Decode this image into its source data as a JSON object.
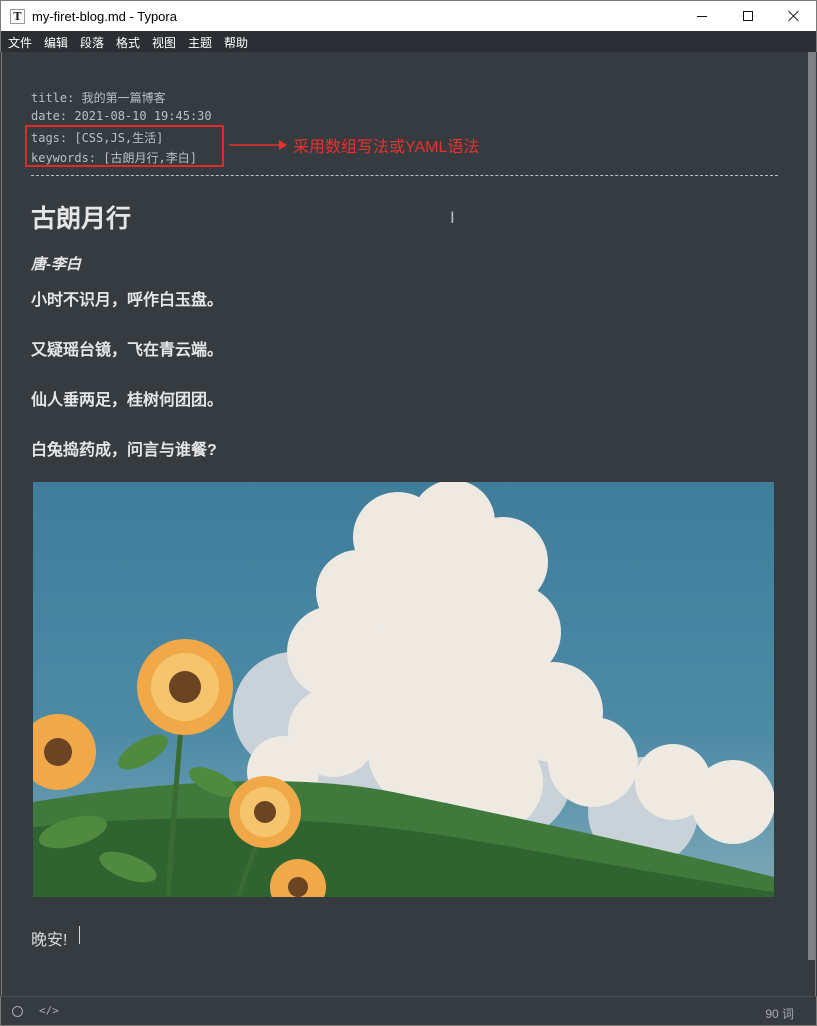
{
  "window": {
    "title": "my-firet-blog.md - Typora",
    "app_icon_letter": "T"
  },
  "menu": [
    "文件",
    "编辑",
    "段落",
    "格式",
    "视图",
    "主题",
    "帮助"
  ],
  "front_matter": {
    "title": "title: 我的第一篇博客",
    "date": "date: 2021-08-10 19:45:30",
    "tags": "tags: [CSS,JS,生活]",
    "keywords": "keywords: [古朗月行,李白]"
  },
  "annotation": "采用数组写法或YAML语法",
  "document": {
    "heading": "古朗月行",
    "author": "唐-李白",
    "lines": [
      "小时不识月，呼作白玉盘。",
      "又疑瑶台镜，飞在青云端。",
      "仙人垂两足，桂树何团团。",
      "白兔捣药成，问言与谁餐?"
    ],
    "closing": "晚安!"
  },
  "image": {
    "subject": "sunflowers-under-cumulus-clouds"
  },
  "status_bar": {
    "source_mode_icon": "</>",
    "word_count": "90 词"
  },
  "colors": {
    "background": "#363b40",
    "text": "#e6e6e6",
    "front_matter_text": "#b8bfc6",
    "annotation_red": "#e8302f"
  }
}
